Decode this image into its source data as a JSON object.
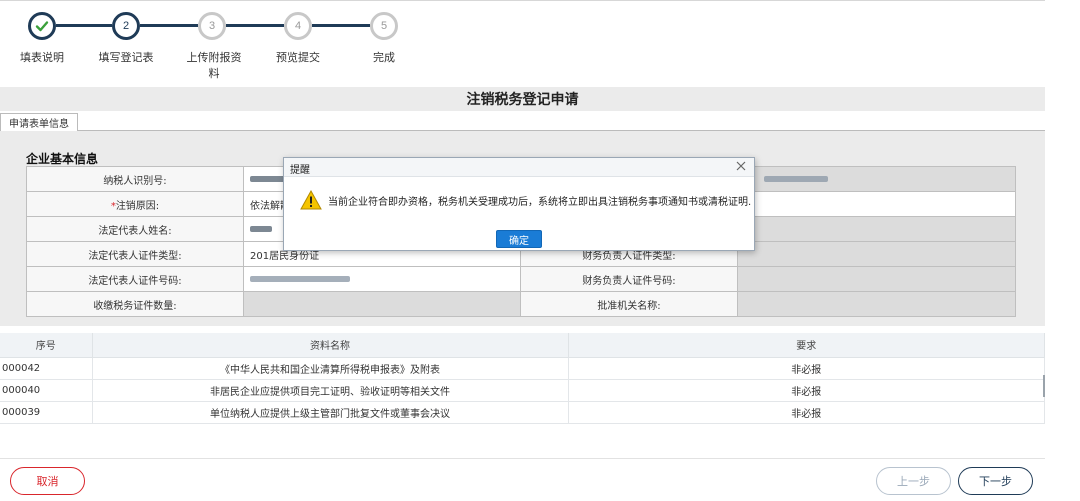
{
  "stepper": {
    "steps": [
      {
        "number": "✓",
        "label": "填表说明",
        "state": "done"
      },
      {
        "number": "2",
        "label": "填写登记表",
        "state": "active"
      },
      {
        "number": "3",
        "label": "上传附报资料",
        "state": "pending"
      },
      {
        "number": "4",
        "label": "预览提交",
        "state": "pending"
      },
      {
        "number": "5",
        "label": "完成",
        "state": "pending"
      }
    ]
  },
  "page": {
    "title": "注销税务登记申请",
    "tab_label": "申请表单信息",
    "section_title": "企业基本信息"
  },
  "form": {
    "row1": {
      "label": "纳税人识别号:",
      "right_label": ""
    },
    "row2": {
      "label_required_mark": "*",
      "label": "注销原因:",
      "value": "依法解散"
    },
    "row3": {
      "label": "法定代表人姓名:"
    },
    "row4": {
      "label": "法定代表人证件类型:",
      "value": "201居民身份证",
      "right_label": "财务负责人证件类型:"
    },
    "row5": {
      "label": "法定代表人证件号码:",
      "right_label": "财务负责人证件号码:"
    },
    "row6": {
      "label": "收缴税务证件数量:",
      "right_label": "批准机关名称:"
    }
  },
  "modal": {
    "title": "提醒",
    "message": "当前企业符合即办资格，税务机关受理成功后，系统将立即出具注销税务事项通知书或清税证明.",
    "ok_label": "确定"
  },
  "documents": {
    "headers": {
      "no": "序号",
      "name": "资料名称",
      "requirement": "要求"
    },
    "rows": [
      {
        "no": "000042",
        "name": "《中华人民共和国企业清算所得税申报表》及附表",
        "requirement": "非必报"
      },
      {
        "no": "000040",
        "name": "非居民企业应提供项目完工证明、验收证明等相关文件",
        "requirement": "非必报"
      },
      {
        "no": "000039",
        "name": "单位纳税人应提供上级主管部门批复文件或董事会决议",
        "requirement": "非必报"
      }
    ]
  },
  "footer": {
    "cancel_label": "取消",
    "prev_label": "上一步",
    "next_label": "下一步"
  },
  "colors": {
    "accent": "#1f3b57",
    "danger": "#d9262c",
    "modal_button": "#1a7cd6"
  }
}
